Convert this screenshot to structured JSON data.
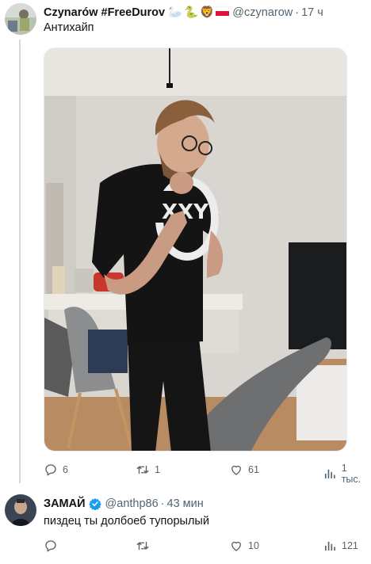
{
  "tweets": [
    {
      "author": "Czynarów #FreeDurov",
      "emojis": [
        "🦢",
        "🐍",
        "🦁",
        "🇵🇱"
      ],
      "handle": "@czynarow",
      "time": "17 ч",
      "text": "Антихайп",
      "has_image": true,
      "actions": {
        "replies": "6",
        "retweets": "1",
        "likes": "61",
        "views": "1 тыс."
      }
    },
    {
      "author": "ЗАМАЙ",
      "verified": true,
      "handle": "@anthp86",
      "time": "43 мин",
      "text": "пиздец ты долбоеб тупорылый",
      "actions": {
        "replies": "",
        "retweets": "",
        "likes": "10",
        "views": "121"
      }
    }
  ],
  "colors": {
    "text_primary": "#0f1419",
    "text_secondary": "#536471",
    "verified_blue": "#1d9bf0",
    "thread_line": "#cfd9de"
  },
  "icons": [
    "reply-icon",
    "retweet-icon",
    "like-icon",
    "views-icon",
    "verified-badge-icon"
  ]
}
